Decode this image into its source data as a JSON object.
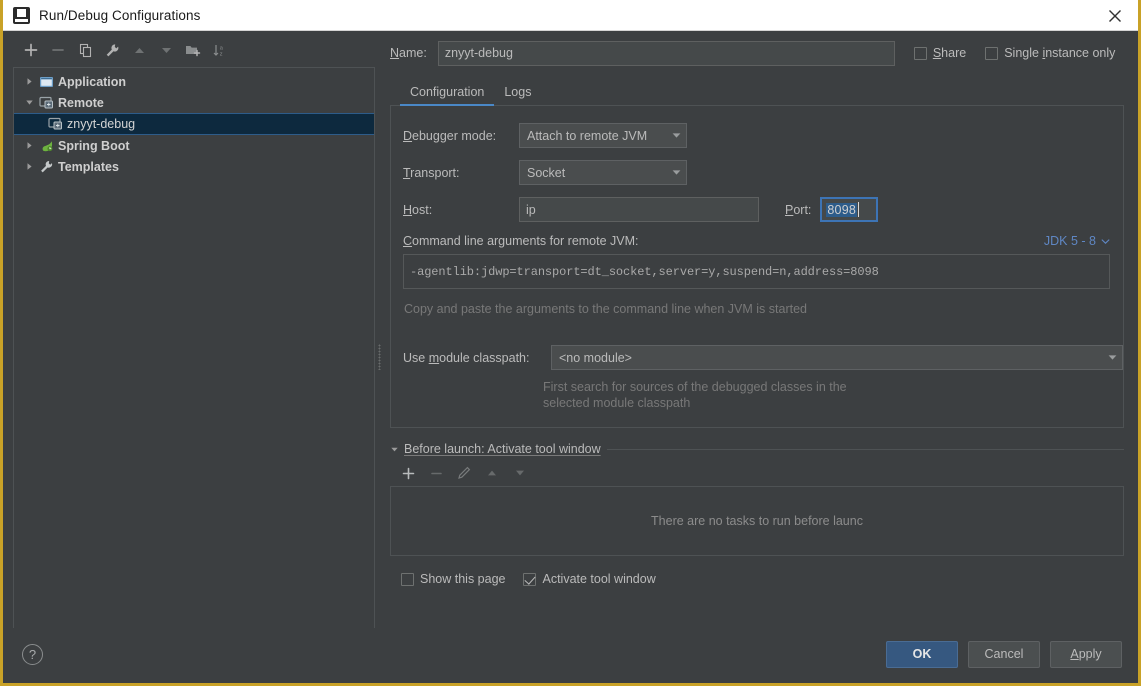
{
  "window": {
    "title": "Run/Debug Configurations",
    "app_icon": "intellij-idea-icon",
    "close_icon": "close-icon",
    "accent_color": "#c9a227",
    "primary_button_color": "#365880",
    "selection_color": "#0d293e",
    "link_color": "#5f87c4"
  },
  "sidebar": {
    "toolbar": [
      {
        "name": "add-configuration-button",
        "icon": "plus-icon",
        "enabled": true
      },
      {
        "name": "remove-configuration-button",
        "icon": "minus-icon",
        "enabled": false
      },
      {
        "name": "copy-configuration-button",
        "icon": "copy-icon",
        "enabled": true
      },
      {
        "name": "edit-templates-button",
        "icon": "wrench-icon",
        "enabled": true
      },
      {
        "name": "move-up-button",
        "icon": "arrow-up-icon",
        "enabled": false
      },
      {
        "name": "move-down-button",
        "icon": "arrow-down-icon",
        "enabled": false
      },
      {
        "name": "new-folder-button",
        "icon": "folder-add-icon",
        "enabled": true
      },
      {
        "name": "sort-configurations-button",
        "icon": "sort-alphabetical-icon",
        "enabled": true
      }
    ],
    "tree": [
      {
        "label": "Application",
        "icon": "application-icon",
        "expanded": false,
        "level": 0,
        "group": true,
        "selected": false
      },
      {
        "label": "Remote",
        "icon": "remote-icon",
        "expanded": true,
        "level": 0,
        "group": true,
        "selected": false
      },
      {
        "label": "znyyt-debug",
        "icon": "remote-icon",
        "level": 1,
        "group": false,
        "selected": true
      },
      {
        "label": "Spring Boot",
        "icon": "spring-boot-icon",
        "expanded": false,
        "level": 0,
        "group": true,
        "selected": false
      },
      {
        "label": "Templates",
        "icon": "wrench-icon",
        "expanded": false,
        "level": 0,
        "group": true,
        "selected": false
      }
    ]
  },
  "form": {
    "name_label": "Name:",
    "name_mnemonic": "N",
    "name_value": "znyyt-debug",
    "share_label": "Share",
    "share_mnemonic": "S",
    "share_checked": false,
    "single_instance_label": "Single instance only",
    "single_instance_checked": false,
    "tabs": [
      {
        "label": "Configuration",
        "active": true
      },
      {
        "label": "Logs",
        "active": false
      }
    ],
    "debugger_mode_label": "Debugger mode:",
    "debugger_mode_value": "Attach to remote JVM",
    "transport_label": "Transport:",
    "transport_value": "Socket",
    "host_label": "Host:",
    "host_value": "ip",
    "port_label": "Port:",
    "port_value": "8098",
    "cmdline_label": "Command line arguments for remote JVM:",
    "jdk_link": "JDK 5 - 8",
    "cmdline_value": "-agentlib:jdwp=transport=dt_socket,server=y,suspend=n,address=8098",
    "cmdline_hint": "Copy and paste the arguments to the command line when JVM is started",
    "classpath_label": "Use module classpath:",
    "classpath_value": "<no module>",
    "classpath_hint": "First search for sources of the debugged classes in the selected module classpath"
  },
  "before_launch": {
    "title": "Before launch: Activate tool window",
    "toolbar": [
      {
        "name": "add-task-button",
        "icon": "plus-icon",
        "enabled": true
      },
      {
        "name": "remove-task-button",
        "icon": "minus-icon",
        "enabled": false
      },
      {
        "name": "edit-task-button",
        "icon": "pencil-icon",
        "enabled": false
      },
      {
        "name": "move-task-up-button",
        "icon": "arrow-up-icon",
        "enabled": false
      },
      {
        "name": "move-task-down-button",
        "icon": "arrow-down-icon",
        "enabled": false
      }
    ],
    "empty_text": "There are no tasks to run before launc",
    "show_page_label": "Show this page",
    "show_page_checked": false,
    "activate_tool_window_label": "Activate tool window",
    "activate_tool_window_checked": true
  },
  "footer": {
    "help_label": "?",
    "ok_label": "OK",
    "cancel_label": "Cancel",
    "apply_label": "Apply"
  }
}
